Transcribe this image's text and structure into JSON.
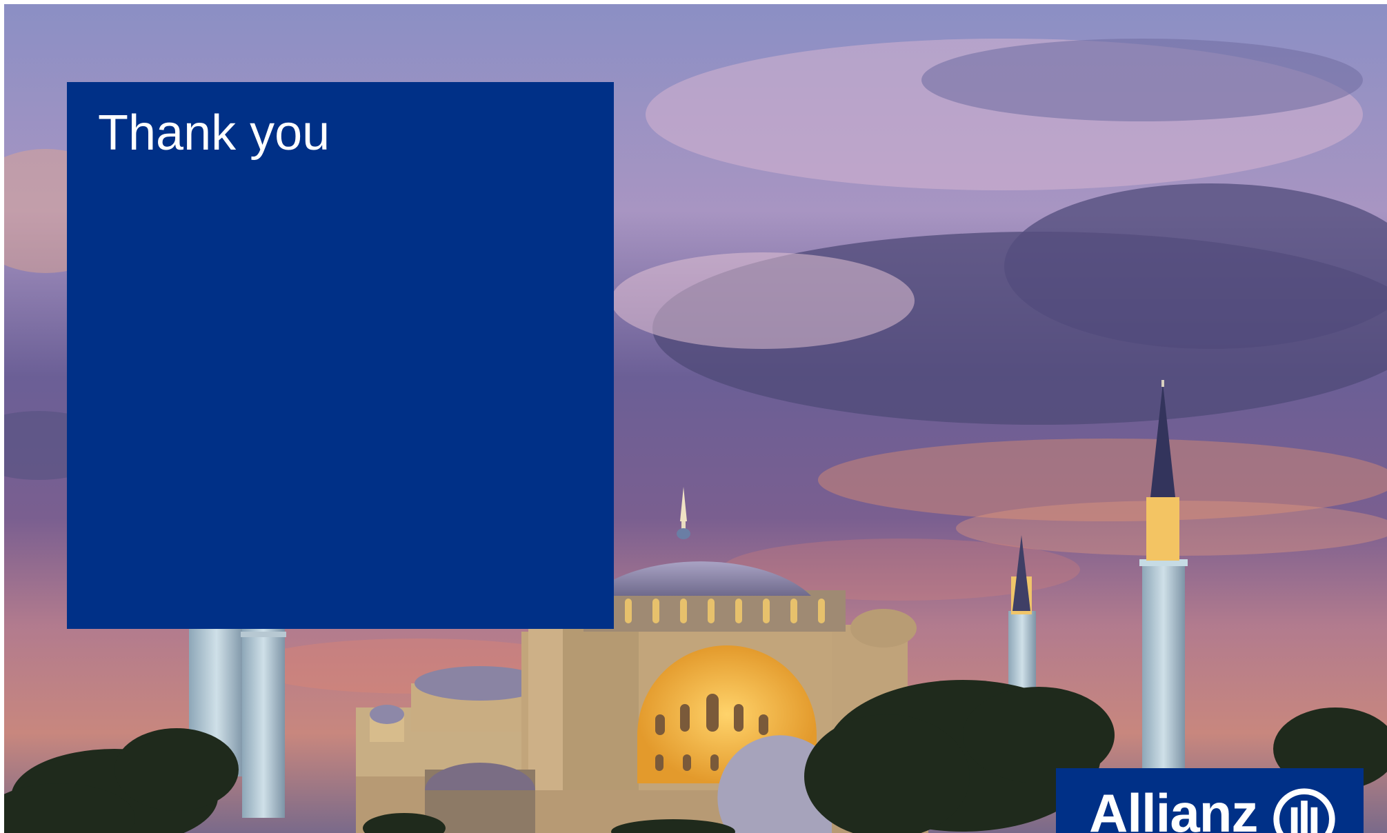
{
  "slide": {
    "title": "Thank you"
  },
  "brand": {
    "name": "Allianz",
    "color": "#003087"
  },
  "colors": {
    "panel": "#003087",
    "text": "#ffffff"
  }
}
